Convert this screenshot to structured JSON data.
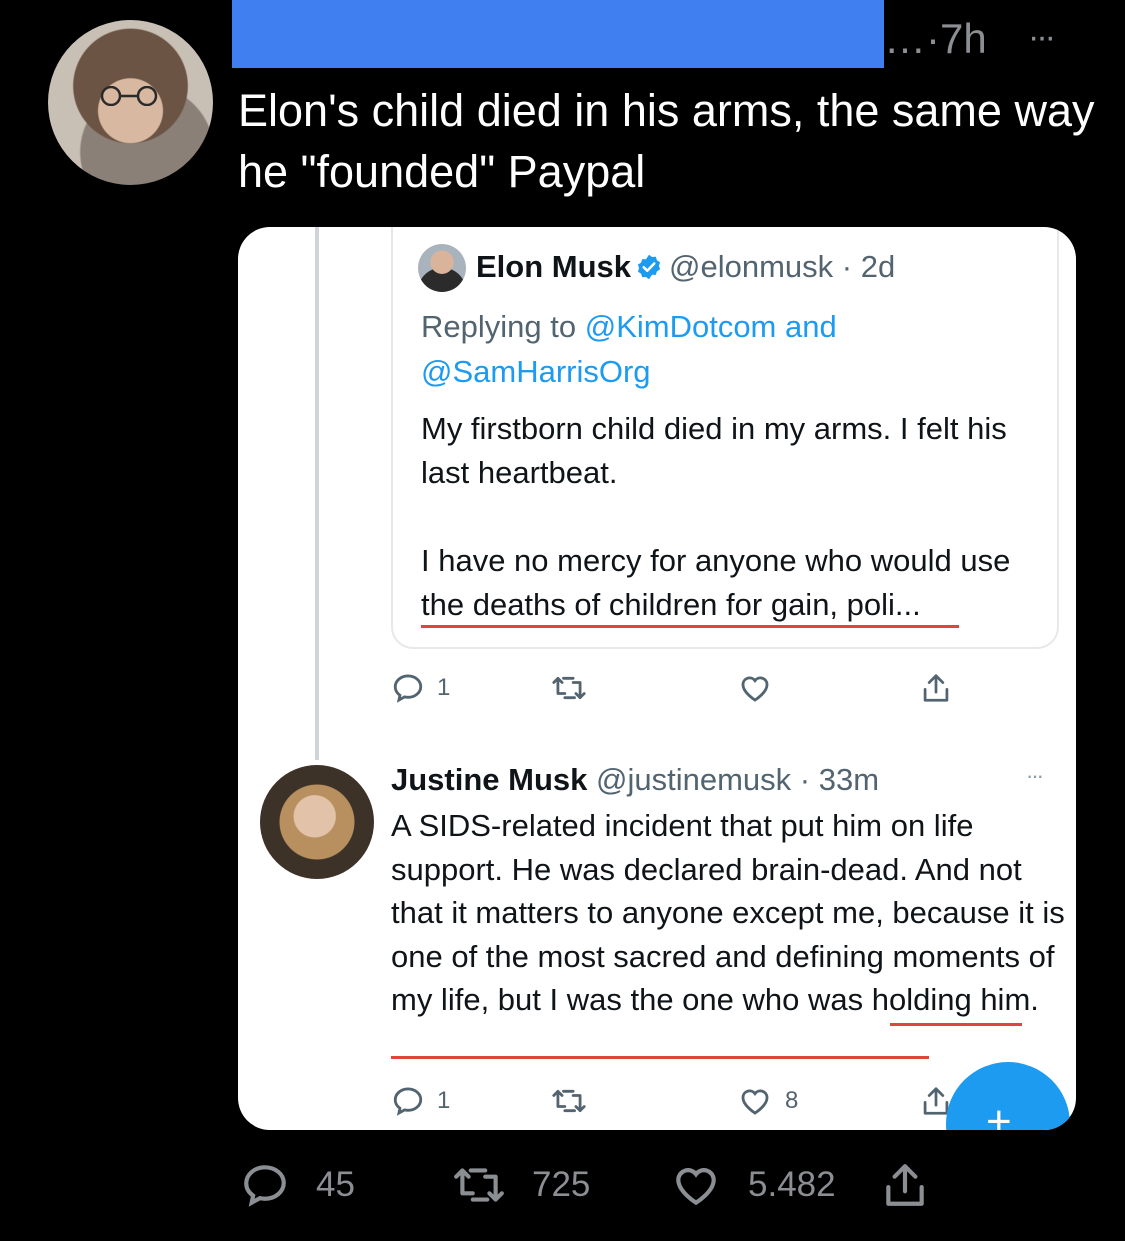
{
  "tweet": {
    "time": "…·7h",
    "more": "···",
    "text": "Elon's child died in his arms, the same way he \"founded\" Paypal"
  },
  "quoted_tweet": {
    "name": "Elon Musk",
    "handle": "@elonmusk",
    "time": "· 2d",
    "replying_prefix": "Replying to",
    "replying_to_1": "@KimDotcom",
    "replying_and": "and",
    "replying_to_2": "@SamHarrisOrg",
    "body_p1": "My firstborn child died in my arms. I felt his last heartbeat.",
    "body_p2": "I have no mercy for anyone who would use the deaths of children for gain, poli...",
    "replies": "1"
  },
  "reply_tweet": {
    "name": "Justine Musk",
    "handle": "@justinemusk",
    "time": "· 33m",
    "more": "···",
    "body": "A SIDS-related incident that put him on life support. He was declared brain-dead. And not that it matters to anyone except me, because it is one of the most sacred and defining moments of my life, but I was the one who was holding him.",
    "replies": "1",
    "likes": "8"
  },
  "fab_label": "+",
  "stats": {
    "replies": "45",
    "retweets": "725",
    "likes": "5.482"
  },
  "colors": {
    "accent": "#1d9bf0",
    "redaction": "#3f7ff0",
    "underline": "#e0453a"
  }
}
